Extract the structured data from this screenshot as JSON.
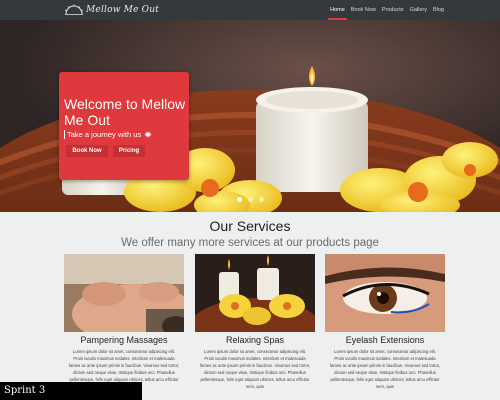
{
  "brand": {
    "name": "Mellow Me Out",
    "logo_icon": "sunrise-icon"
  },
  "nav": {
    "items": [
      {
        "label": "Home",
        "active": true
      },
      {
        "label": "Book Now",
        "active": false
      },
      {
        "label": "Products",
        "active": false
      },
      {
        "label": "Gallery",
        "active": false
      },
      {
        "label": "Blog",
        "active": false
      }
    ]
  },
  "hero": {
    "title": "Welcome to Mellow Me Out",
    "subtitle": "Take a journey with us",
    "subtitle_icon": "maple-leaf-icon",
    "buttons": {
      "book": "Book Now",
      "pricing": "Pricing"
    },
    "slides": 3,
    "active_slide": 1,
    "card_color": "#de3a3e"
  },
  "services": {
    "title": "Our Services",
    "subtitle": "We offer many more services at our products page",
    "cards": [
      {
        "title": "Pampering Massages",
        "text": "Lorem ipsum dolor sit amet, consectetur adipiscing elit. Proin iaculis maximus sodales. Interdum et malesuada fames ac ante ipsum primis in faucibus. Vivamus sed tortor, dictum sed neque vitae, tristique finibus orci. Phasellus pellentesque, felis eget aliquam ultrices, tellus arcu efficitur sem, quis"
      },
      {
        "title": "Relaxing Spas",
        "text": "Lorem ipsum dolor sit amet, consectetur adipiscing elit. Proin iaculis maximus sodales. Interdum et malesuada fames ac ante ipsum primis in faucibus. Vivamus sed tortor, dictum sed neque vitae, tristique finibus orci. Phasellus pellentesque, felis eget aliquam ultrices, tellus arcu efficitur sem, quis"
      },
      {
        "title": "Eyelash Extensions",
        "text": "Lorem ipsum dolor sit amet, consectetur adipiscing elit. Proin iaculis maximus sodales. Interdum et malesuada fames ac ante ipsum primis in faucibus. Vivamus sed tortor, dictum sed neque vitae, tristique finibus orci. Phasellus pellentesque, felis eget aliquam ultrices, tellus arcu efficitur sem, quis"
      }
    ]
  },
  "overlay_label": "Sprint 3"
}
